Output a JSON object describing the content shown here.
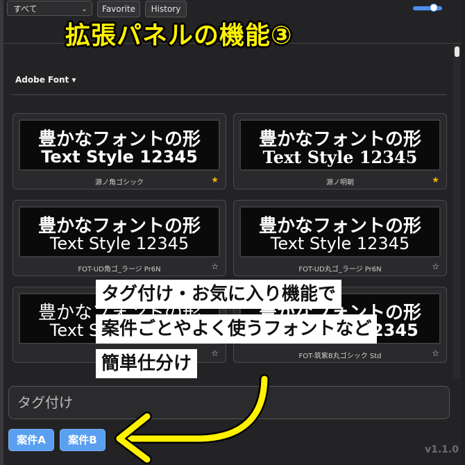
{
  "toolbar": {
    "category_select": "すべて",
    "favorite_label": "Favorite",
    "history_label": "History",
    "zoom_level": 0.75
  },
  "overlay_title": "拡張パネルの機能③",
  "section": {
    "label": "Adobe Font ▾"
  },
  "fonts": [
    {
      "preview_line1": "豊かなフォントの形",
      "preview_line2": "Text Style 12345",
      "name": "源ノ角ゴシック",
      "favorite": true,
      "star": "★"
    },
    {
      "preview_line1": "豊かなフォントの形",
      "preview_line2": "Text Style 12345",
      "name": "源ノ明朝",
      "favorite": true,
      "star": "★"
    },
    {
      "preview_line1": "豊かなフォントの形",
      "preview_line2": "Text Style 12345",
      "name": "FOT-UD角ゴ_ラージ Pr6N",
      "favorite": false,
      "star": "☆"
    },
    {
      "preview_line1": "豊かなフォントの形",
      "preview_line2": "Text Style 12345",
      "name": "FOT-UD丸ゴ_ラージ Pr6N",
      "favorite": false,
      "star": "☆"
    },
    {
      "preview_line1": "豊かなフォントの形",
      "preview_line2": "Text Style 12345",
      "name": "FOT-",
      "favorite": false,
      "star": "☆"
    },
    {
      "preview_line1": "豊かなフォントの形",
      "preview_line2": "Text Style 12345",
      "name": "FOT-筑紫B丸ゴシック Std",
      "favorite": false,
      "star": "☆"
    }
  ],
  "callout": {
    "line1": "タグ付け・お気に入り機能で",
    "line2": "案件ごとやよく使うフォントなど",
    "line3": "簡単仕分け"
  },
  "tag_input": {
    "placeholder": "タグ付け"
  },
  "tags": [
    "案件A",
    "案件B"
  ],
  "version": "v1.1.0",
  "colors": {
    "accent": "#5a9ff0",
    "title": "#fff200",
    "star_favorite": "#f5b400",
    "arrow": "#fff200"
  }
}
